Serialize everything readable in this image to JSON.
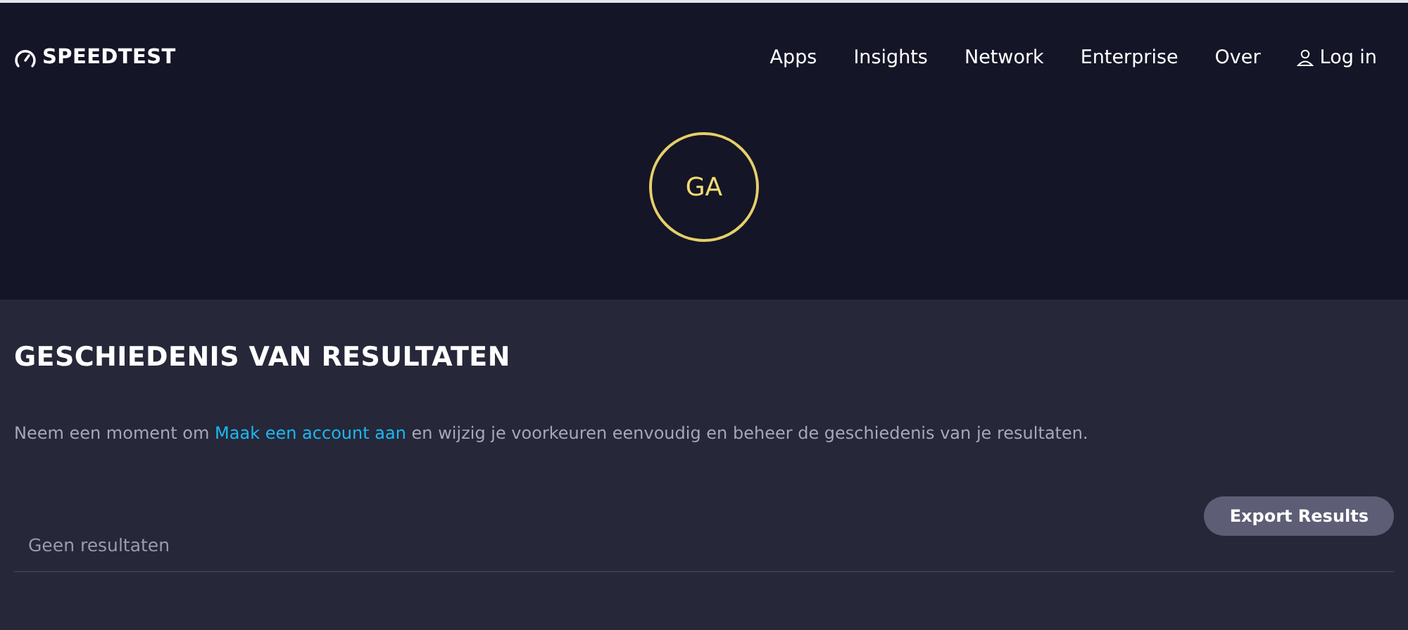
{
  "header": {
    "logo": "SPEEDTEST",
    "nav": [
      "Apps",
      "Insights",
      "Network",
      "Enterprise",
      "Over"
    ],
    "login": "Log in"
  },
  "avatar": {
    "initials": "GA"
  },
  "history": {
    "title": "GESCHIEDENIS VAN RESULTATEN",
    "intro_before": "Neem een moment om ",
    "intro_link": "Maak een account aan",
    "intro_after": " en wijzig je voorkeuren eenvoudig en beheer de geschiedenis van je resultaten.",
    "export_button": "Export Results",
    "empty_text": "Geen resultaten"
  }
}
